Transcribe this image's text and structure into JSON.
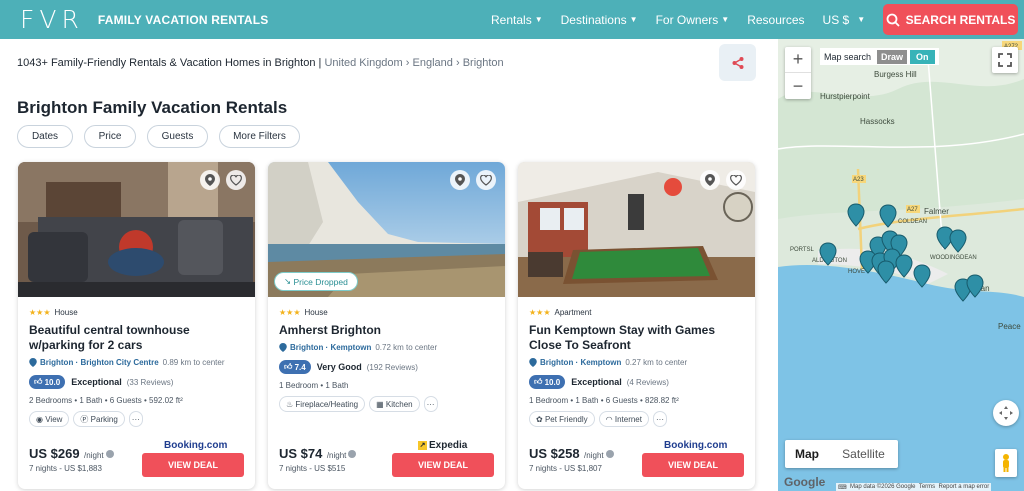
{
  "header": {
    "logo_mark": "FVR",
    "logo_text": "FAMILY VACATION RENTALS",
    "nav": [
      {
        "label": "Rentals",
        "has_chevron": true
      },
      {
        "label": "Destinations",
        "has_chevron": true
      },
      {
        "label": "For Owners",
        "has_chevron": true
      },
      {
        "label": "Resources",
        "has_chevron": false
      },
      {
        "label": "US $",
        "has_chevron": true
      }
    ],
    "search_label": "SEARCH RENTALS",
    "colors": {
      "bar": "#4db0b8",
      "accent": "#f0505a"
    }
  },
  "breadcrumb": {
    "count_text": "1043+ Family-Friendly Rentals & Vacation Homes in Brighton |",
    "path": [
      "United Kingdom",
      "England",
      "Brighton"
    ]
  },
  "page_title": "Brighton Family Vacation Rentals",
  "filters": [
    "Dates",
    "Price",
    "Guests",
    "More Filters"
  ],
  "listings": [
    {
      "stars": 3,
      "type": "House",
      "title": "Beautiful central townhouse w/parking for 2 cars",
      "city": "Brighton",
      "area": "Brighton City Centre",
      "distance": "0.89 km to center",
      "score": "10.0",
      "rating_label": "Exceptional",
      "reviews": "(33 Reviews)",
      "specs": "2 Bedrooms • 1 Bath • 6 Guests • 592.02 ft²",
      "amenities": [
        {
          "label": "View",
          "icon": "eye-icon"
        },
        {
          "label": "Parking",
          "icon": "parking-icon"
        }
      ],
      "price": "US $269",
      "per": "/night",
      "total": "7 nights - US $1,883",
      "provider": "Booking.com",
      "deal_label": "VIEW DEAL",
      "price_dropped": ""
    },
    {
      "stars": 3,
      "type": "House",
      "title": "Amherst Brighton",
      "city": "Brighton",
      "area": "Kemptown",
      "distance": "0.72 km to center",
      "score": "7.4",
      "rating_label": "Very Good",
      "reviews": "(192 Reviews)",
      "specs": "1 Bedroom • 1 Bath",
      "amenities": [
        {
          "label": "Fireplace/Heating",
          "icon": "fire-icon"
        },
        {
          "label": "Kitchen",
          "icon": "kitchen-icon"
        }
      ],
      "price": "US $74",
      "per": "/night",
      "total": "7 nights - US $515",
      "provider": "Expedia",
      "deal_label": "VIEW DEAL",
      "price_dropped": "Price Dropped"
    },
    {
      "stars": 3,
      "type": "Apartment",
      "title": "Fun Kemptown Stay with Games Close To Seafront",
      "city": "Brighton",
      "area": "Kemptown",
      "distance": "0.27 km to center",
      "score": "10.0",
      "rating_label": "Exceptional",
      "reviews": "(4 Reviews)",
      "specs": "1 Bedroom • 1 Bath • 6 Guests • 828.82 ft²",
      "amenities": [
        {
          "label": "Pet Friendly",
          "icon": "paw-icon"
        },
        {
          "label": "Internet",
          "icon": "wifi-icon"
        }
      ],
      "price": "US $258",
      "per": "/night",
      "total": "7 nights - US $1,807",
      "provider": "Booking.com",
      "deal_label": "VIEW DEAL",
      "price_dropped": ""
    }
  ],
  "map": {
    "search_label": "Map search",
    "draw_label": "Draw",
    "on_label": "On",
    "type_map": "Map",
    "type_satellite": "Satellite",
    "place_labels": [
      "Burgess Hill",
      "Hurstpierpoint",
      "Hassocks",
      "Falmer",
      "COLDEAN",
      "PORTSL",
      "ALDINGTON",
      "HOVE",
      "WOODINGDEAN",
      "Saltdean",
      "Peace"
    ],
    "road_labels": [
      "A272",
      "A23",
      "A27"
    ],
    "footer": [
      "Map data ©2026 Google",
      "Terms",
      "Report a map error"
    ],
    "google_label": "Google"
  }
}
